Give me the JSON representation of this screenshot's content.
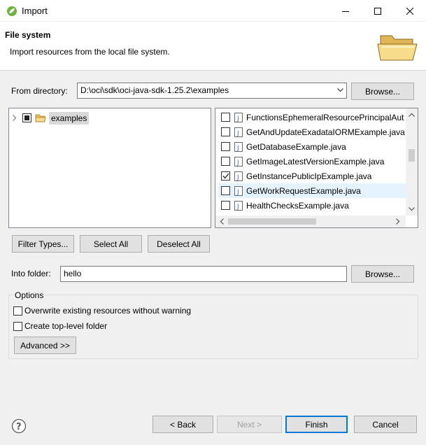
{
  "window": {
    "title": "Import",
    "minimize_icon": "minimize-icon",
    "maximize_icon": "maximize-icon",
    "close_icon": "close-icon"
  },
  "banner": {
    "title": "File system",
    "description": "Import resources from the local file system.",
    "icon": "open-folder-icon"
  },
  "from_directory": {
    "label": "From directory:",
    "value": "D:\\oci\\sdk\\oci-java-sdk-1.25.2\\examples",
    "browse_label": "Browse..."
  },
  "tree": {
    "items": [
      {
        "label": "examples",
        "state": "partial",
        "expanded": false
      }
    ]
  },
  "files": [
    {
      "name": "FunctionsEphemeralResourcePrincipalAut",
      "checked": false
    },
    {
      "name": "GetAndUpdateExadataIORMExample.java",
      "checked": false
    },
    {
      "name": "GetDatabaseExample.java",
      "checked": false
    },
    {
      "name": "GetImageLatestVersionExample.java",
      "checked": false
    },
    {
      "name": "GetInstancePublicIpExample.java",
      "checked": true
    },
    {
      "name": "GetWorkRequestExample.java",
      "checked": false
    },
    {
      "name": "HealthChecksExample.java",
      "checked": false
    }
  ],
  "selection_buttons": {
    "filter_types": "Filter Types...",
    "select_all": "Select All",
    "deselect_all": "Deselect All"
  },
  "into_folder": {
    "label": "Into folder:",
    "value": "hello",
    "browse_label": "Browse..."
  },
  "options": {
    "legend": "Options",
    "overwrite_label": "Overwrite existing resources without warning",
    "overwrite_checked": false,
    "top_level_label": "Create top-level folder",
    "top_level_checked": false,
    "advanced_label": "Advanced >>"
  },
  "footer": {
    "help_icon": "help-icon",
    "back_label": "< Back",
    "next_label": "Next >",
    "finish_label": "Finish",
    "cancel_label": "Cancel"
  },
  "colors": {
    "accent": "#0078d7",
    "hover_row": "#e5f3ff",
    "dialog_bg": "#f0f0f0"
  }
}
